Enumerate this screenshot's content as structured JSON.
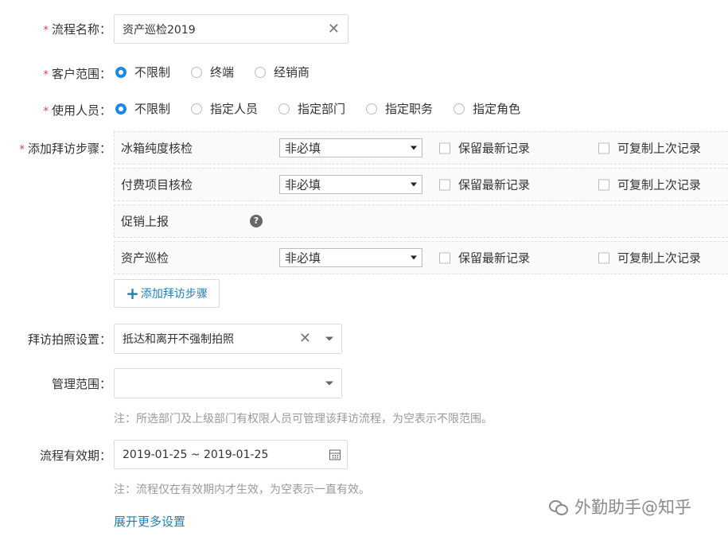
{
  "flow_name": {
    "label": "流程名称：",
    "value": "资产巡检2019"
  },
  "customer_scope": {
    "label": "客户范围：",
    "options": [
      "不限制",
      "终端",
      "经销商"
    ],
    "selected": 0
  },
  "users": {
    "label": "使用人员：",
    "options": [
      "不限制",
      "指定人员",
      "指定部门",
      "指定职务",
      "指定角色"
    ],
    "selected": 0
  },
  "visit_steps": {
    "label": "添加拜访步骤：",
    "rows": [
      {
        "name": "冰箱纯度核检",
        "select": "非必填",
        "keep_latest": "保留最新记录",
        "copy_last": "可复制上次记录"
      },
      {
        "name": "付费项目核检",
        "select": "非必填",
        "keep_latest": "保留最新记录",
        "copy_last": "可复制上次记录"
      },
      {
        "name": "促销上报",
        "help": "?"
      },
      {
        "name": "资产巡检",
        "select": "非必填",
        "keep_latest": "保留最新记录",
        "copy_last": "可复制上次记录"
      }
    ],
    "add_button": "添加拜访步骤"
  },
  "photo_setting": {
    "label": "拜访拍照设置：",
    "value": "抵达和离开不强制拍照"
  },
  "manage_scope": {
    "label": "管理范围：",
    "value": "",
    "note": "注：所选部门及上级部门有权限人员可管理该拜访流程，为空表示不限范围。"
  },
  "validity": {
    "label": "流程有效期：",
    "value": "2019-01-25 ~ 2019-01-25",
    "note": "注：流程仅在有效期内才生效，为空表示一直有效。"
  },
  "expand_link": "展开更多设置",
  "watermark": "外勤助手@知乎",
  "colors": {
    "accent": "#1e88e5",
    "link": "#1e7fb8",
    "required": "#e4393c"
  },
  "icons": [
    "clear-icon",
    "chevron-down-icon",
    "help-icon",
    "plus-icon",
    "calendar-icon",
    "wechat-icon"
  ]
}
